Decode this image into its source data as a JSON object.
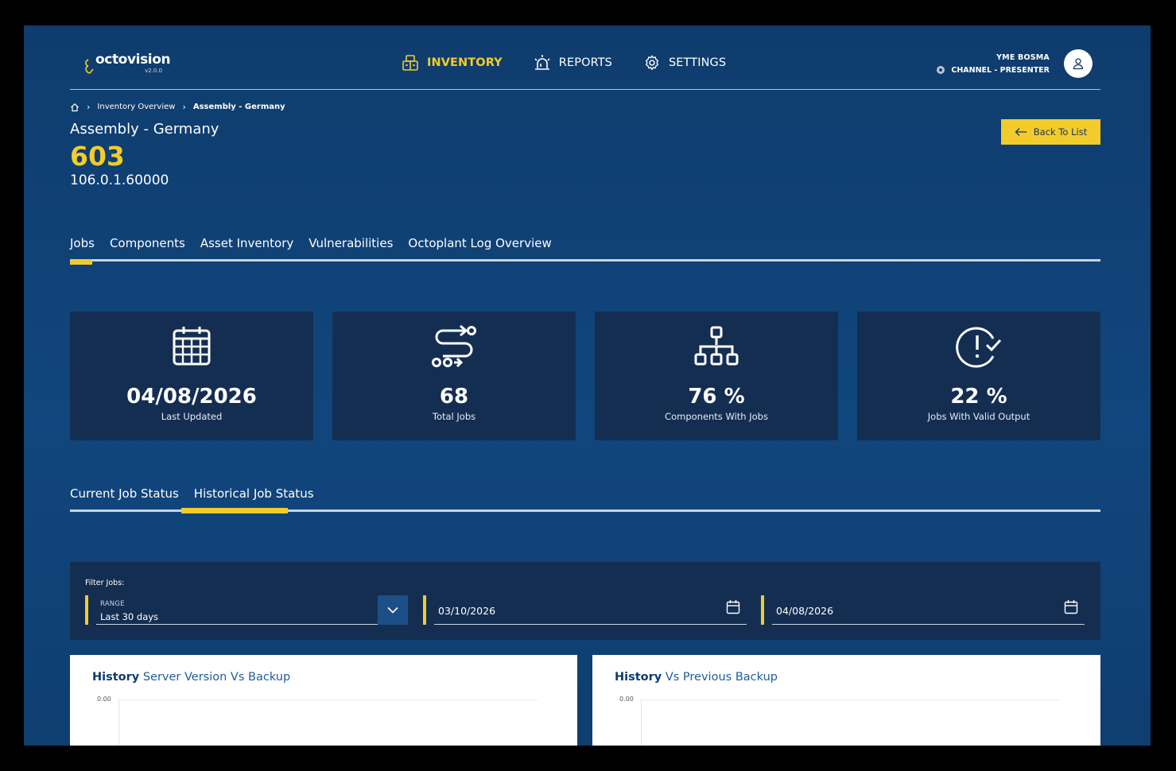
{
  "header": {
    "logo_text": "octovision",
    "logo_version": "v2.0.0",
    "nav": [
      {
        "label": "INVENTORY",
        "icon": "inventory-boxes-icon",
        "active": true
      },
      {
        "label": "REPORTS",
        "icon": "siren-icon",
        "active": false
      },
      {
        "label": "SETTINGS",
        "icon": "gear-icon",
        "active": false
      }
    ],
    "user": {
      "name": "YME BOSMA",
      "role": "CHANNEL - PRESENTER",
      "avatar_icon": "user-icon"
    }
  },
  "breadcrumb": {
    "home_icon": "home-icon",
    "items": [
      "Inventory Overview",
      "Assembly - Germany"
    ]
  },
  "page": {
    "title": "Assembly - Germany",
    "id": "603",
    "version": "106.0.1.60000",
    "back_label": "Back To List"
  },
  "main_tabs": [
    "Jobs",
    "Components",
    "Asset Inventory",
    "Vulnerabilities",
    "Octoplant Log Overview"
  ],
  "main_tab_active": "Jobs",
  "stats": [
    {
      "icon": "calendar-icon",
      "value": "04/08/2026",
      "label": "Last Updated"
    },
    {
      "icon": "route-icon",
      "value": "68",
      "label": "Total Jobs"
    },
    {
      "icon": "hierarchy-icon",
      "value": "76 %",
      "label": "Components With Jobs"
    },
    {
      "icon": "clock-alert-check-icon",
      "value": "22 %",
      "label": "Jobs With Valid Output"
    }
  ],
  "job_tabs": [
    "Current Job Status",
    "Historical Job Status"
  ],
  "job_tab_active": "Historical Job Status",
  "filter": {
    "title": "Filter Jobs:",
    "range_label": "RANGE",
    "range_value": "Last 30 days",
    "date_from": "03/10/2026",
    "date_to": "04/08/2026"
  },
  "charts": [
    {
      "title_bold": "History",
      "title_rest": " Server Version Vs Backup",
      "tick": "0.00"
    },
    {
      "title_bold": "History",
      "title_rest": " Vs Previous Backup",
      "tick": "0.00"
    }
  ],
  "colors": {
    "accent": "#f2cc2a",
    "background": "#10467d",
    "card": "#142e52"
  }
}
